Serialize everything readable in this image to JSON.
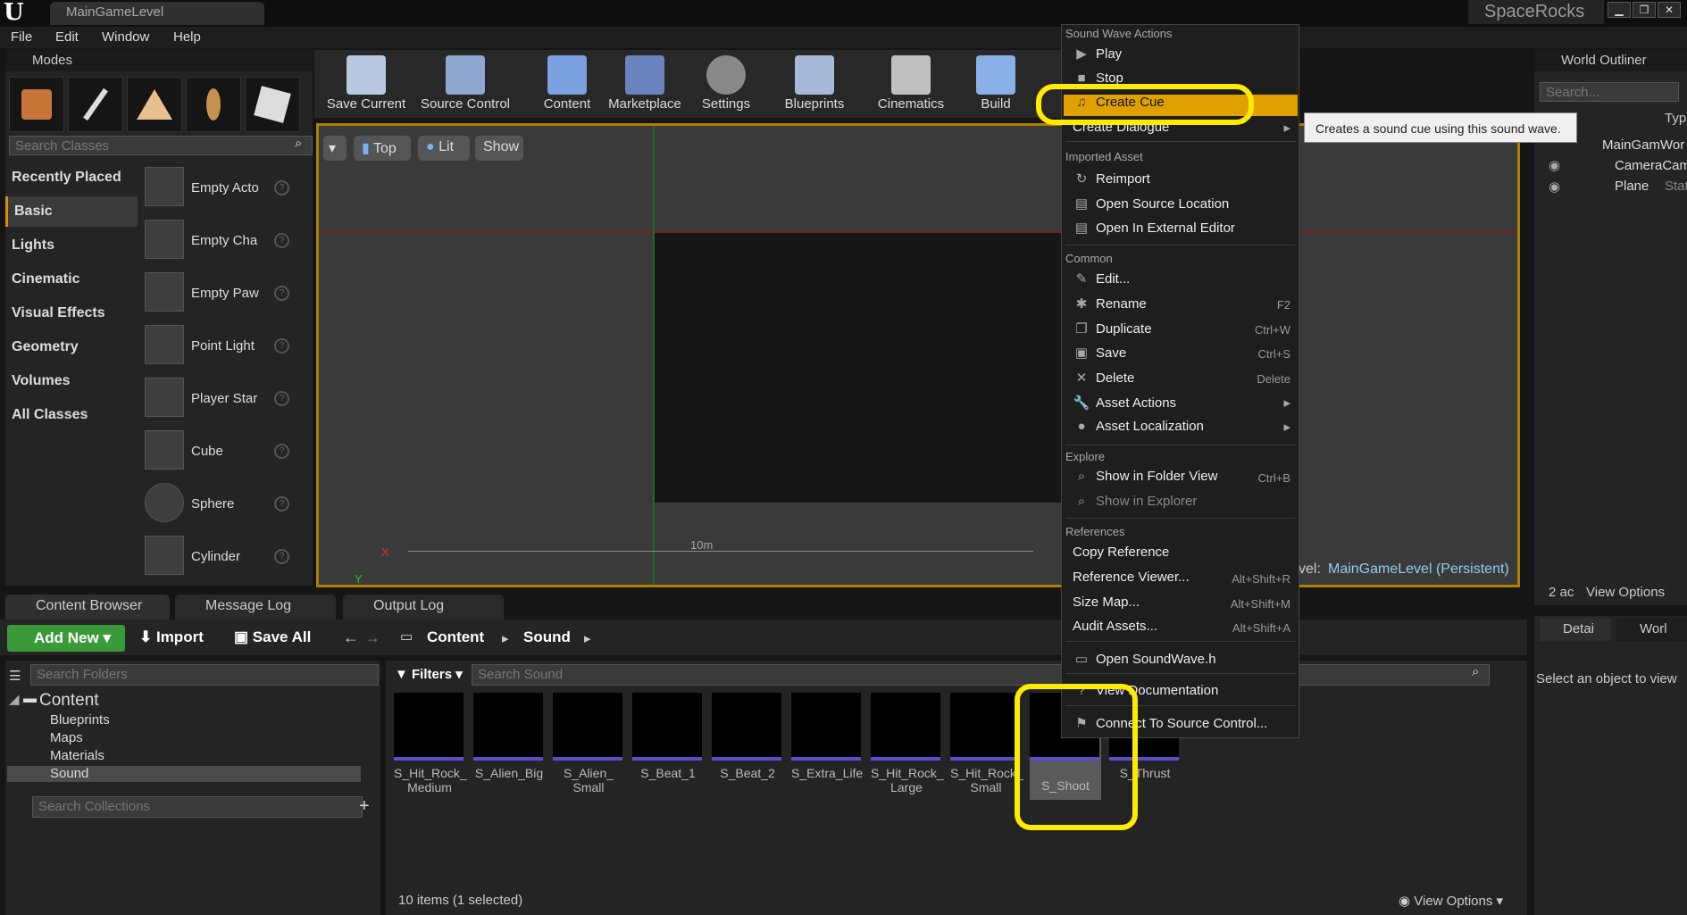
{
  "app": {
    "level_tab": "MainGameLevel",
    "brand": "SpaceRocks",
    "menus": [
      "File",
      "Edit",
      "Window",
      "Help"
    ]
  },
  "modes": {
    "title": "Modes",
    "search_placeholder": "Search Classes",
    "categories": [
      "Recently Placed",
      "Basic",
      "Lights",
      "Cinematic",
      "Visual Effects",
      "Geometry",
      "Volumes",
      "All Classes"
    ],
    "items": [
      "Empty Acto",
      "Empty Cha",
      "Empty Paw",
      "Point Light",
      "Player Star",
      "Cube",
      "Sphere",
      "Cylinder"
    ]
  },
  "toolbar": {
    "tools": [
      "Save Current",
      "Source Control",
      "Content",
      "Marketplace",
      "Settings",
      "Blueprints",
      "Cinematics",
      "Build"
    ]
  },
  "viewport": {
    "view": "Top",
    "lit": "Lit",
    "show": "Show",
    "scale": "10m",
    "axis_x": "X",
    "axis_y": "Y",
    "level_prefix": "vel:",
    "level_name": "MainGameLevel (Persistent)"
  },
  "context_menu": {
    "sections": [
      "Sound Wave Actions",
      "Imported Asset",
      "Common",
      "Explore",
      "References"
    ],
    "items": [
      {
        "label": "Play",
        "shortcut": ""
      },
      {
        "label": "Stop",
        "shortcut": ""
      },
      {
        "label": "Create Cue",
        "shortcut": ""
      },
      {
        "label": "Create Dialogue",
        "shortcut": ""
      },
      {
        "label": "Reimport",
        "shortcut": ""
      },
      {
        "label": "Open Source Location",
        "shortcut": ""
      },
      {
        "label": "Open In External Editor",
        "shortcut": ""
      },
      {
        "label": "Edit...",
        "shortcut": ""
      },
      {
        "label": "Rename",
        "shortcut": "F2"
      },
      {
        "label": "Duplicate",
        "shortcut": "Ctrl+W"
      },
      {
        "label": "Save",
        "shortcut": "Ctrl+S"
      },
      {
        "label": "Delete",
        "shortcut": "Delete"
      },
      {
        "label": "Asset Actions",
        "shortcut": ""
      },
      {
        "label": "Asset Localization",
        "shortcut": ""
      },
      {
        "label": "Show in Folder View",
        "shortcut": "Ctrl+B"
      },
      {
        "label": "Show in Explorer",
        "shortcut": ""
      },
      {
        "label": "Copy Reference",
        "shortcut": ""
      },
      {
        "label": "Reference Viewer...",
        "shortcut": "Alt+Shift+R"
      },
      {
        "label": "Size Map...",
        "shortcut": "Alt+Shift+M"
      },
      {
        "label": "Audit Assets...",
        "shortcut": "Alt+Shift+A"
      },
      {
        "label": "Open SoundWave.h",
        "shortcut": ""
      },
      {
        "label": "View Documentation",
        "shortcut": ""
      },
      {
        "label": "Connect To Source Control...",
        "shortcut": ""
      }
    ],
    "tooltip": "Creates a sound cue using this sound wave."
  },
  "outliner": {
    "title": "World Outliner",
    "search_placeholder": "Search...",
    "col_label": "el",
    "col_type": "Typ",
    "rows": [
      {
        "name": "MainGamWor",
        "type": ""
      },
      {
        "name": "CameraCam",
        "type": ""
      },
      {
        "name": "Plane",
        "type": "Stat"
      }
    ],
    "count": "2 ac",
    "view_options": "View Options"
  },
  "details": {
    "tab1": "Detai",
    "tab2": "Worl",
    "empty_msg": "Select an object to view"
  },
  "bottom_tabs": [
    "Content Browser",
    "Message Log",
    "Output Log"
  ],
  "content_browser": {
    "add_new": "Add New",
    "import": "Import",
    "save_all": "Save All",
    "path": [
      "Content",
      "Sound"
    ],
    "folder_search": "Search Folders",
    "collection_search": "Search Collections",
    "filters": "Filters",
    "asset_search": "Search Sound",
    "tree": [
      "Content",
      "Blueprints",
      "Maps",
      "Materials",
      "Sound"
    ],
    "assets": [
      "S_Hit_Rock_\nMedium",
      "S_Alien_Big",
      "S_Alien_\nSmall",
      "S_Beat_1",
      "S_Beat_2",
      "S_Extra_Life",
      "S_Hit_Rock_\nLarge",
      "S_Hit_Rock_\nSmall",
      "S_Shoot",
      "S_Thrust"
    ],
    "status": "10 items (1 selected)",
    "view_options": "View Options"
  }
}
